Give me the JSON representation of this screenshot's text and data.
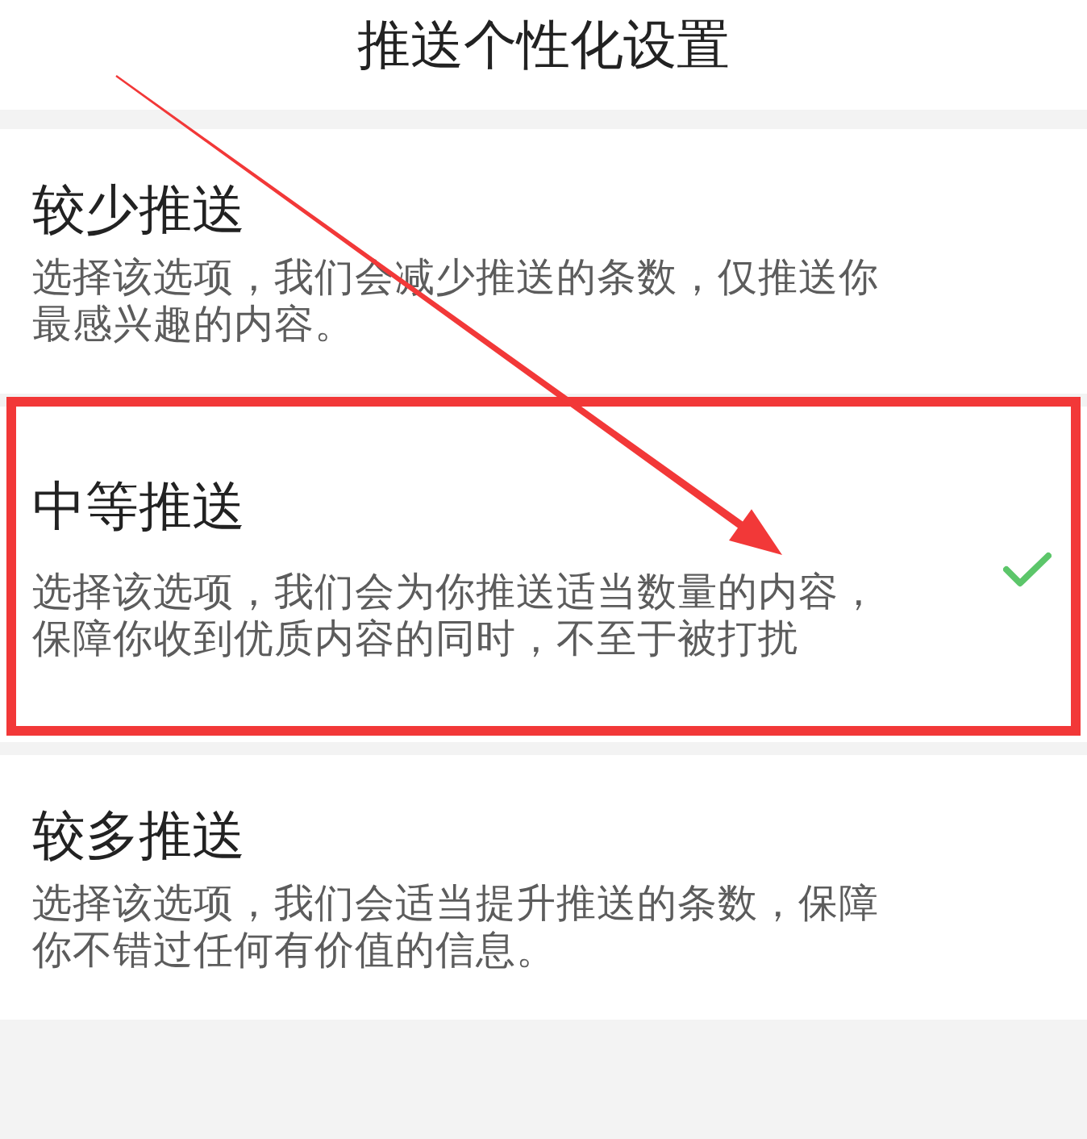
{
  "header": {
    "title": "推送个性化设置"
  },
  "options": [
    {
      "title": "较少推送",
      "description": "选择该选项，我们会减少推送的条数，仅推送你最感兴趣的内容。",
      "selected": false,
      "highlighted": false
    },
    {
      "title": "中等推送",
      "description": "选择该选项，我们会为你推送适当数量的内容，保障你收到优质内容的同时，不至于被打扰",
      "selected": true,
      "highlighted": true
    },
    {
      "title": "较多推送",
      "description": "选择该选项，我们会适当提升推送的条数，保障你不错过任何有价值的信息。",
      "selected": false,
      "highlighted": false
    }
  ],
  "annotations": [
    {
      "kind": "arrow"
    }
  ]
}
